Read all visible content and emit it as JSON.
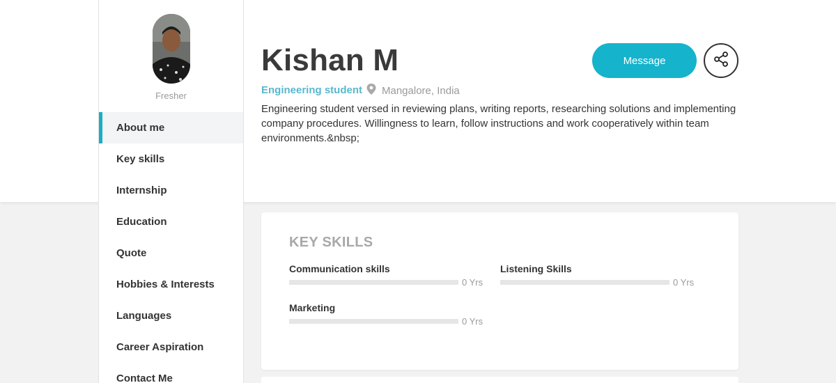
{
  "sidebar": {
    "status": "Fresher",
    "items": [
      {
        "label": "About me",
        "active": true
      },
      {
        "label": "Key skills"
      },
      {
        "label": "Internship"
      },
      {
        "label": "Education"
      },
      {
        "label": "Quote"
      },
      {
        "label": "Hobbies & Interests"
      },
      {
        "label": "Languages"
      },
      {
        "label": "Career Aspiration"
      },
      {
        "label": "Contact Me"
      }
    ]
  },
  "profile": {
    "name": "Kishan M",
    "role": "Engineering student",
    "location": "Mangalore, India",
    "bio": "Engineering student versed in reviewing plans, writing reports, researching solutions and implementing company procedures. Willingness to learn, follow instructions and work cooperatively within team environments.&nbsp;"
  },
  "actions": {
    "message_label": "Message",
    "share_icon": "share-icon"
  },
  "key_skills": {
    "title": "KEY SKILLS",
    "skills": [
      {
        "name": "Communication skills",
        "years": "0 Yrs",
        "level": 0
      },
      {
        "name": "Listening Skills",
        "years": "0 Yrs",
        "level": 0
      },
      {
        "name": "Marketing",
        "years": "0 Yrs",
        "level": 0
      }
    ]
  },
  "colors": {
    "accent": "#15b3cc",
    "role_text": "#59b8cc",
    "background": "#f2f2f2"
  }
}
